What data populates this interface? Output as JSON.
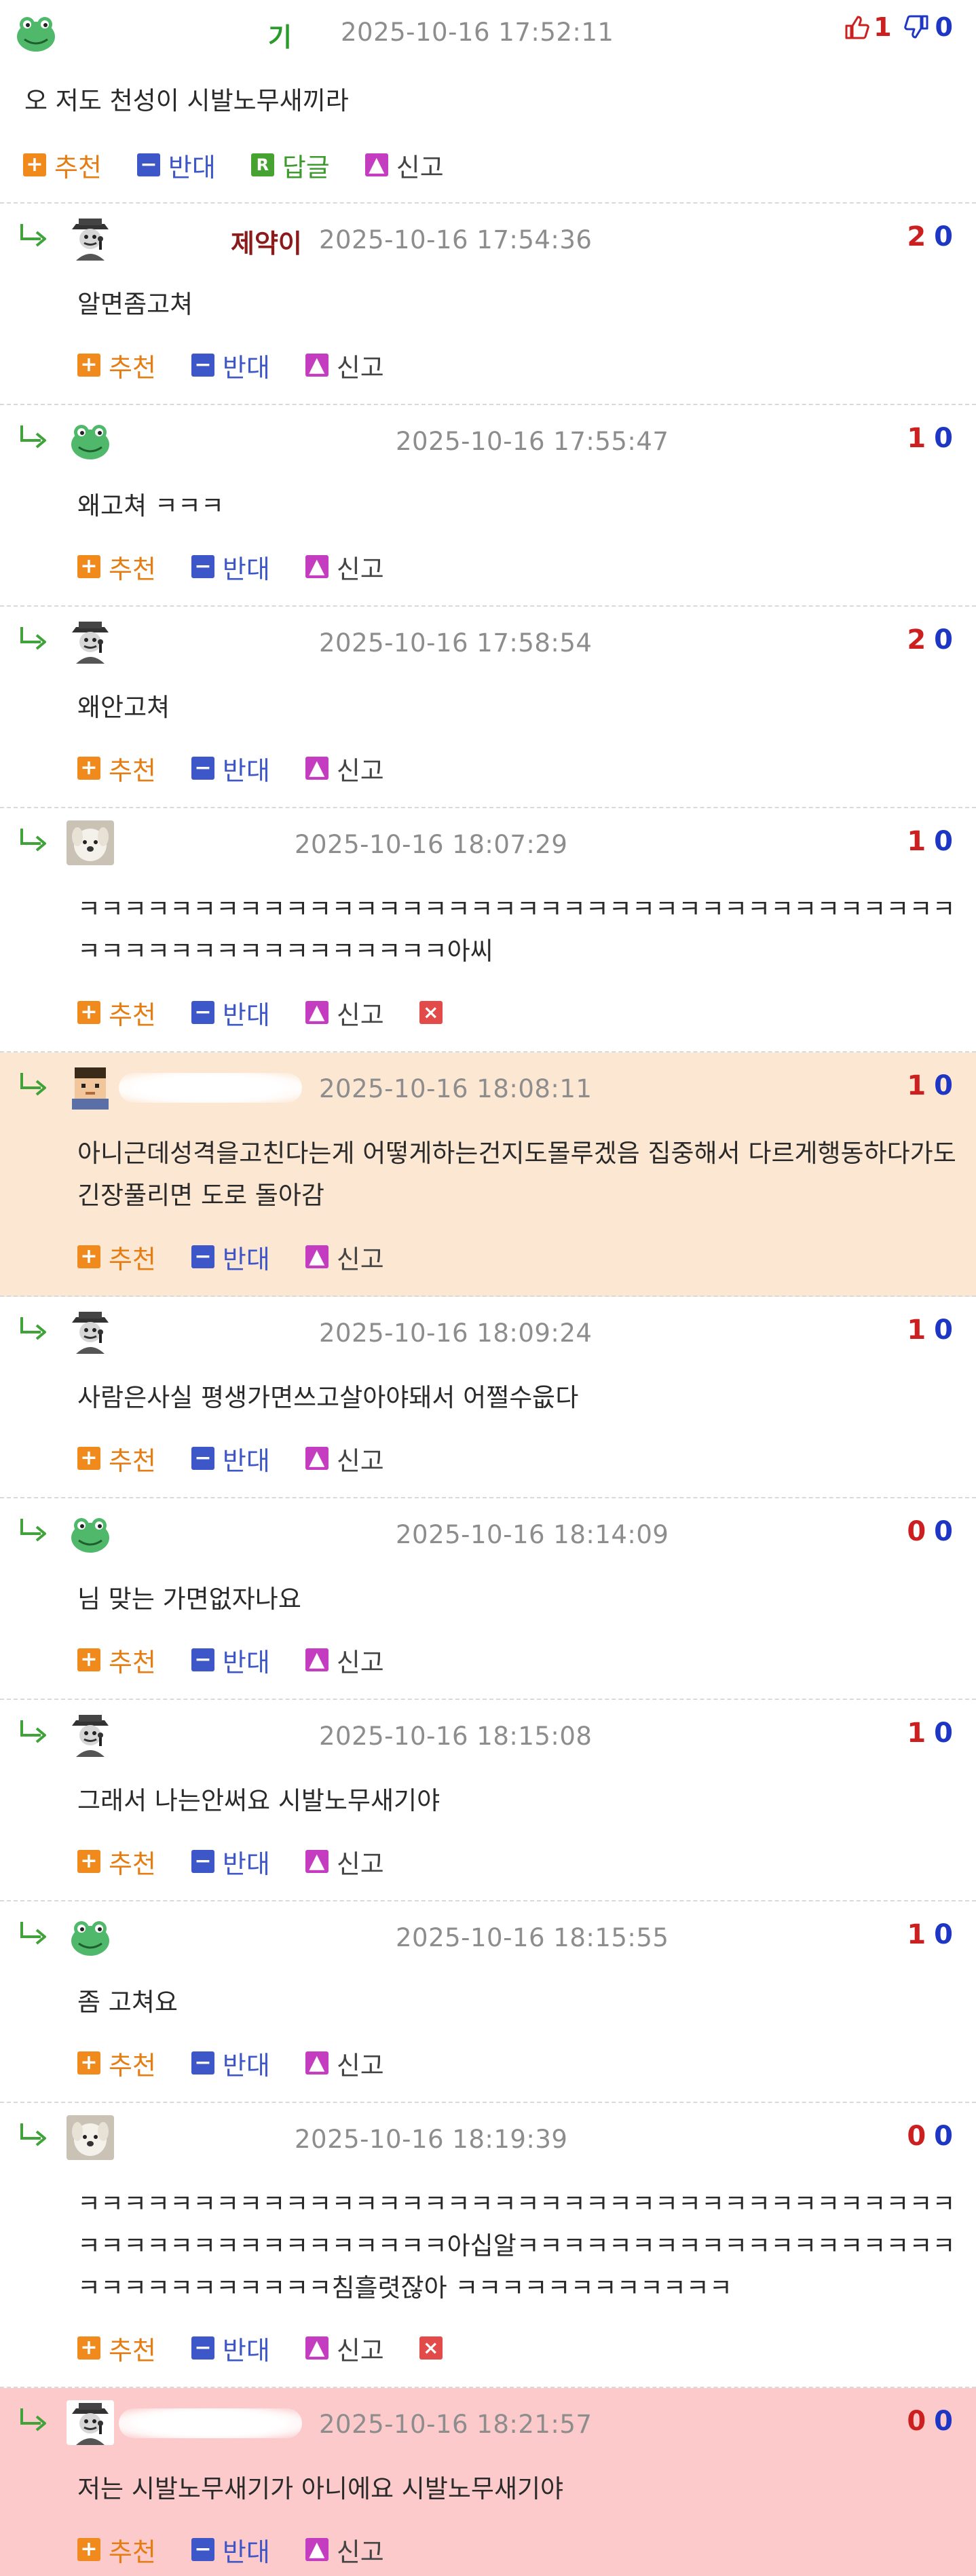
{
  "top_comment": {
    "nickname_fragment": "기",
    "timestamp": "2025-10-16 17:52:11",
    "likes": "1",
    "dislikes": "0",
    "body": "오 저도 천성이 시발노무새끼라",
    "actions": {
      "up": "추천",
      "down": "반대",
      "reply": "답글",
      "report": "신고"
    }
  },
  "actions": {
    "up": "추천",
    "down": "반대",
    "report": "신고"
  },
  "replies": [
    {
      "avatar": "detective-avatar-icon",
      "nickname_fragment": "제약이",
      "nick_color": "#8b1a1a",
      "timestamp": "2025-10-16 17:54:36",
      "up": "2",
      "down": "0",
      "body": "알면좀고쳐",
      "highlight": "",
      "deletable": false
    },
    {
      "avatar": "frog-avatar-icon",
      "nickname_fragment": "",
      "nick_color": "#2a9a2a",
      "timestamp": "2025-10-16 17:55:47",
      "up": "1",
      "down": "0",
      "body": "왜고쳐 ㅋㅋㅋ",
      "highlight": "",
      "deletable": false
    },
    {
      "avatar": "detective-avatar-icon",
      "nickname_fragment": "",
      "nick_color": "#8b1a1a",
      "timestamp": "2025-10-16 17:58:54",
      "up": "2",
      "down": "0",
      "body": "왜안고쳐",
      "highlight": "",
      "deletable": false
    },
    {
      "avatar": "dog-avatar-icon",
      "nickname_fragment": "",
      "nick_color": "#8b1a1a",
      "timestamp": "2025-10-16 18:07:29",
      "up": "1",
      "down": "0",
      "body": "ㅋㅋㅋㅋㅋㅋㅋㅋㅋㅋㅋㅋㅋㅋㅋㅋㅋㅋㅋㅋㅋㅋㅋㅋㅋㅋㅋㅋㅋㅋㅋㅋㅋㅋㅋㅋㅋㅋㅋㅋㅋㅋㅋㅋㅋㅋㅋㅋㅋㅋㅋㅋㅋㅋ아씨",
      "highlight": "",
      "deletable": true
    },
    {
      "avatar": "pixel-avatar-icon",
      "nickname_fragment": "",
      "nick_color": "#8b1a1a",
      "timestamp": "2025-10-16 18:08:11",
      "up": "1",
      "down": "0",
      "body": "아니근데성격을고친다는게 어떻게하는건지도몰루겠음 집중해서 다르게행동하다가도 긴장풀리면 도로 돌아감",
      "highlight": "peach",
      "deletable": false
    },
    {
      "avatar": "detective-avatar-icon",
      "nickname_fragment": "",
      "nick_color": "#8b1a1a",
      "timestamp": "2025-10-16 18:09:24",
      "up": "1",
      "down": "0",
      "body": "사람은사실 평생가면쓰고살아야돼서 어쩔수읎다",
      "highlight": "",
      "deletable": false
    },
    {
      "avatar": "frog-avatar-icon",
      "nickname_fragment": "",
      "nick_color": "#2a9a2a",
      "timestamp": "2025-10-16 18:14:09",
      "up": "0",
      "down": "0",
      "body": "님 맞는 가면없자나요",
      "highlight": "",
      "deletable": false
    },
    {
      "avatar": "detective-avatar-icon",
      "nickname_fragment": "",
      "nick_color": "#8b1a1a",
      "timestamp": "2025-10-16 18:15:08",
      "up": "1",
      "down": "0",
      "body": "그래서 나는안써요 시발노무새기야",
      "highlight": "",
      "deletable": false
    },
    {
      "avatar": "frog-avatar-icon",
      "nickname_fragment": "",
      "nick_color": "#2a9a2a",
      "timestamp": "2025-10-16 18:15:55",
      "up": "1",
      "down": "0",
      "body": "좀 고쳐요",
      "highlight": "",
      "deletable": false
    },
    {
      "avatar": "dog-avatar-icon",
      "nickname_fragment": "",
      "nick_color": "#8b1a1a",
      "timestamp": "2025-10-16 18:19:39",
      "up": "0",
      "down": "0",
      "body": "ㅋㅋㅋㅋㅋㅋㅋㅋㅋㅋㅋㅋㅋㅋㅋㅋㅋㅋㅋㅋㅋㅋㅋㅋㅋㅋㅋㅋㅋㅋㅋㅋㅋㅋㅋㅋㅋㅋㅋㅋㅋㅋㅋㅋㅋㅋㅋㅋㅋㅋㅋㅋㅋㅋ아십알ㅋㅋㅋㅋㅋㅋㅋㅋㅋㅋㅋㅋㅋㅋㅋㅋㅋㅋㅋㅋㅋㅋㅋㅋㅋㅋㅋㅋㅋㅋ침흘렷잖아 ㅋㅋㅋㅋㅋㅋㅋㅋㅋㅋㅋㅋ",
      "highlight": "",
      "deletable": true
    },
    {
      "avatar": "detective-avatar-icon",
      "nickname_fragment": "",
      "nick_color": "#8b1a1a",
      "timestamp": "2025-10-16 18:21:57",
      "up": "0",
      "down": "0",
      "body": "저는 시발노무새기가 아니에요 시발노무새기야",
      "highlight": "pink",
      "deletable": false
    }
  ],
  "colors": {
    "like": "#cc1f1f",
    "dislike": "#1d36c4",
    "recommend": "#f08a1c",
    "oppose": "#3d57c8",
    "reply": "#46a332",
    "report": "#c43cbf",
    "delete": "#e34b4b"
  }
}
